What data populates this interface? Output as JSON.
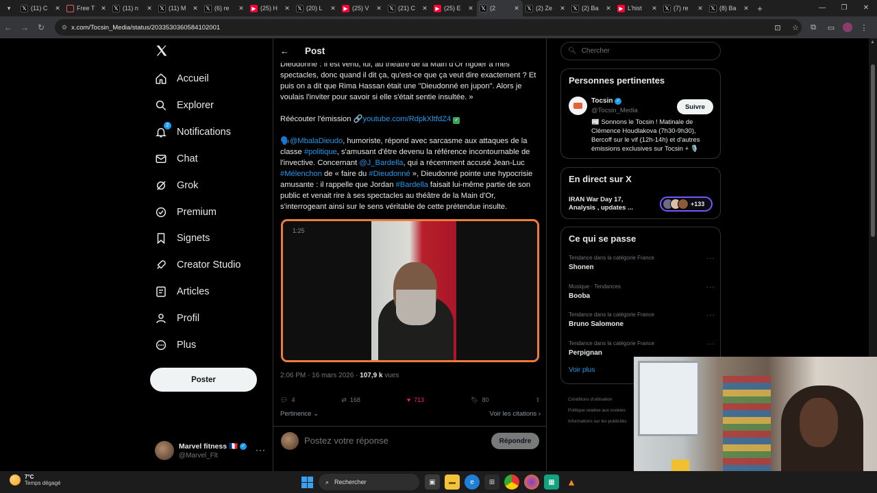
{
  "browser": {
    "tabs": [
      {
        "title": "(11) C",
        "icon": "x-logo-icon"
      },
      {
        "title": "Free T",
        "icon": "globe-icon"
      },
      {
        "title": "(11) n",
        "icon": "x-logo-icon"
      },
      {
        "title": "(11) M",
        "icon": "x-logo-icon"
      },
      {
        "title": "(6) re",
        "icon": "x-logo-icon"
      },
      {
        "title": "(25) H",
        "icon": "youtube-icon"
      },
      {
        "title": "(20) L",
        "icon": "x-logo-icon"
      },
      {
        "title": "(25) V",
        "icon": "youtube-icon"
      },
      {
        "title": "(21) C",
        "icon": "x-logo-icon"
      },
      {
        "title": "(25) E",
        "icon": "youtube-icon"
      },
      {
        "title": "(2",
        "icon": "x-logo-icon",
        "active": true
      },
      {
        "title": "(2) Ze",
        "icon": "x-logo-icon"
      },
      {
        "title": "(2) Ba",
        "icon": "x-logo-icon"
      },
      {
        "title": "L'hist",
        "icon": "youtube-icon"
      },
      {
        "title": "(7) re",
        "icon": "x-logo-icon"
      },
      {
        "title": "(8) Ba",
        "icon": "x-logo-icon"
      }
    ],
    "url": "x.com/Tocsin_Media/status/2033530360584102001"
  },
  "nav": {
    "items": [
      {
        "label": "Accueil",
        "icon": "home-icon"
      },
      {
        "label": "Explorer",
        "icon": "search-icon"
      },
      {
        "label": "Notifications",
        "icon": "bell-icon",
        "badge": "2"
      },
      {
        "label": "Chat",
        "icon": "mail-icon"
      },
      {
        "label": "Grok",
        "icon": "grok-icon"
      },
      {
        "label": "Premium",
        "icon": "premium-icon"
      },
      {
        "label": "Signets",
        "icon": "bookmark-icon"
      },
      {
        "label": "Creator Studio",
        "icon": "rocket-icon"
      },
      {
        "label": "Articles",
        "icon": "article-icon"
      },
      {
        "label": "Profil",
        "icon": "user-icon"
      },
      {
        "label": "Plus",
        "icon": "more-circle-icon"
      }
    ],
    "post_button": "Poster",
    "account": {
      "name": "Marvel fitness",
      "flag": "🇫🇷",
      "handle": "@Marvel_Flt"
    }
  },
  "post": {
    "header_title": "Post",
    "para1": "Dieudonné : Il est venu, lui, au théâtre de la Main d'Or rigoler à mes spectacles, donc quand il dit ça, qu'est-ce que ça veut dire exactement ? Et puis on a dit que Rima Hassan était une \"Dieudonné en jupon\". Alors je voulais l'inviter pour savoir si elle s'était sentie insultée. »",
    "listen_label": "Réécouter l'émission 🔗",
    "listen_link": "youtube.com/RdpkXltfdZ4",
    "p3": {
      "mention1": "@MbalaDieudo",
      "t1": ", humoriste, répond avec sarcasme aux attaques de la classe ",
      "tag1": "#politique",
      "t2": ", s'amusant d'être devenu la référence incontournable de l'invective. Concernant ",
      "mention2": "@J_Bardella",
      "t3": ", qui a récemment accusé Jean-Luc ",
      "tag2": "#Mélenchon",
      "t4": " de « faire du ",
      "tag3": "#Dieudonné",
      "t5": " », Dieudonné pointe une hypocrisie amusante : il rappelle que Jordan ",
      "tag4": "#Bardella",
      "t6": " faisait lui-même partie de son public et venait rire à ses spectacles au théâtre de la Main d'Or, s'interrogeant ainsi sur le sens véritable de cette prétendue insulte."
    },
    "video_time": "1:25",
    "timestamp": "2:06 PM · 16 mars 2026 · ",
    "views": "107,9 k",
    "views_label": " vues",
    "stats": {
      "replies": "4",
      "reposts": "168",
      "likes": "713",
      "bookmarks": "80"
    },
    "relevance_label": "Pertinence",
    "quotes_label": "Voir les citations",
    "reply_placeholder": "Postez votre réponse",
    "reply_button": "Répondre"
  },
  "right": {
    "search_placeholder": "Chercher",
    "people_title": "Personnes pertinentes",
    "person": {
      "name": "Tocsin",
      "handle": "@Tocsin_Media",
      "bio": "📰 Sonnons le Tocsin ! Matinale de Clémence Houdlakova (7h30-9h30), Bercoff sur le vif (12h-14h) et d'autres émissions exclusives sur Tocsin + 🎙️",
      "follow": "Suivre"
    },
    "live_title": "En direct sur X",
    "live_text": "IRAN War Day 17, Analysis , updates ...",
    "live_count": "+133",
    "trends_title": "Ce qui se passe",
    "trends": [
      {
        "meta": "Tendance dans la catégorie France",
        "name": "Shonen"
      },
      {
        "meta": "Musique · Tendances",
        "name": "Booba"
      },
      {
        "meta": "Tendance dans la catégorie France",
        "name": "Bruno Salomone"
      },
      {
        "meta": "Tendance dans la catégorie France",
        "name": "Perpignan"
      }
    ],
    "see_more": "Voir plus",
    "footer": [
      "Conditions d'utilisation",
      "Politique relative aux cookies",
      "Informations sur les publicités"
    ]
  },
  "taskbar": {
    "temp": "7°C",
    "condition": "Temps dégagé",
    "search": "Rechercher",
    "apps": [
      "task-view-icon",
      "folder-icon",
      "edge-icon",
      "store-icon",
      "chrome-icon",
      "firefox-icon",
      "app-icon",
      "vlc-icon"
    ]
  },
  "colors": {
    "accent": "#1d9bf0",
    "like": "#f91880",
    "video_border": "#f07c3c",
    "live_border": "#7856ff"
  }
}
